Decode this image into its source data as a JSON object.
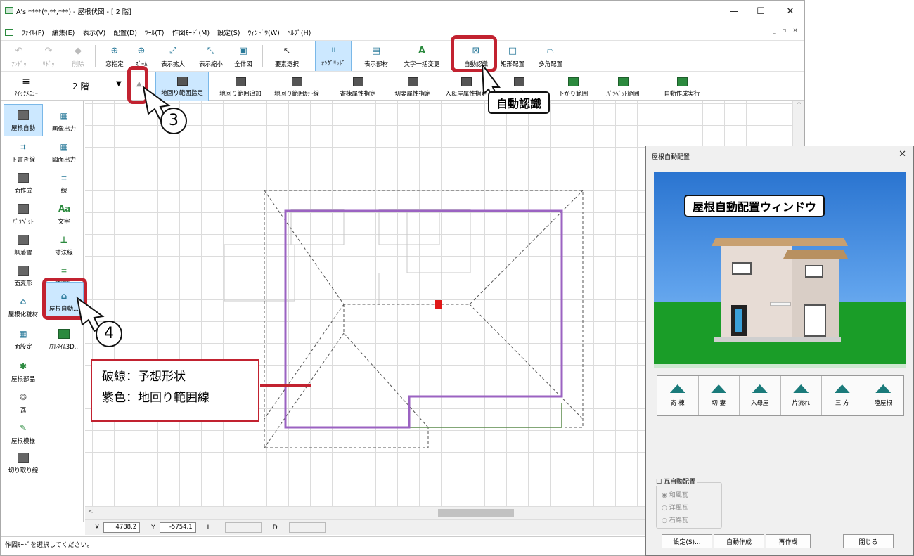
{
  "window": {
    "title": "A's ****(*,**,***) - 屋根伏図 - [ 2 階]"
  },
  "menu": [
    "ﾌｧｲﾙ(F)",
    "編集(E)",
    "表示(V)",
    "配置(D)",
    "ﾂｰﾙ(T)",
    "作図ﾓｰﾄﾞ(M)",
    "設定(S)",
    "ｳｨﾝﾄﾞｳ(W)",
    "ﾍﾙﾌﾟ(H)"
  ],
  "toolbar1": [
    "ｱﾝﾄﾞｩ",
    "ﾘﾄﾞｩ",
    "削除",
    "窓指定",
    "ｽﾞｰﾑ",
    "表示拡大",
    "表示縮小",
    "全体図",
    "要素選択",
    "ｵﾝｸﾞﾘｯﾄﾞ",
    "表示部材",
    "文字一括変更",
    "自動認識",
    "矩形配置",
    "多角配置"
  ],
  "toolbar2": {
    "quick_menu": "ｸｲｯｸﾒﾆｭｰ",
    "floor": "2 階",
    "items": [
      "地回り範囲指定",
      "地回り範囲追加",
      "地回り範囲ｶｯﾄ線",
      "寄棟属性指定",
      "切妻属性指定",
      "入母屋属性指定",
      "ｹﾗﾊﾞ範囲",
      "下がり範囲",
      "ﾊﾟﾗﾍﾟｯﾄ範囲",
      "自動作成実行"
    ]
  },
  "leftbar": [
    "屋根自動",
    "画像出力",
    "下書き線",
    "図面出力",
    "面作成",
    "線",
    "ﾊﾟﾗﾍﾟｯﾄ",
    "文字",
    "無落雪",
    "寸法線",
    "面変形",
    "補助線",
    "屋根化粧材",
    "屋根自動...",
    "面設定",
    "ﾘｱﾙﾀｲﾑ3D...",
    "屋根部品",
    "瓦",
    "屋根模様",
    "切り取り線"
  ],
  "coords": {
    "x_label": "X",
    "x": "4788.2",
    "y_label": "Y",
    "y": "-5754.1",
    "l_label": "L",
    "d_label": "D"
  },
  "status": "作図ﾓｰﾄﾞを選択してください。",
  "annotations": {
    "auto_recognize": "自動認識",
    "step3": "3",
    "step4": "4",
    "legend_line1": "破線：予想形状",
    "legend_line2": "紫色：地回り範囲線",
    "dialog_label": "屋根自動配置ウィンドウ"
  },
  "dialog": {
    "title": "屋根自動配置",
    "roof_types": [
      "寄 棟",
      "切 妻",
      "入母屋",
      "片流れ",
      "三 方",
      "陸屋根"
    ],
    "tile_checkbox": "瓦自動配置",
    "tile_options": [
      "和風瓦",
      "洋風瓦",
      "石綿瓦"
    ],
    "buttons": {
      "settings": "設定(S)...",
      "auto_create": "自動作成",
      "recreate": "再作成",
      "close": "閉じる"
    }
  },
  "colors": {
    "accent_red": "#c22230",
    "boundary_purple": "#9b63c2",
    "selection_blue": "#cce8ff"
  }
}
